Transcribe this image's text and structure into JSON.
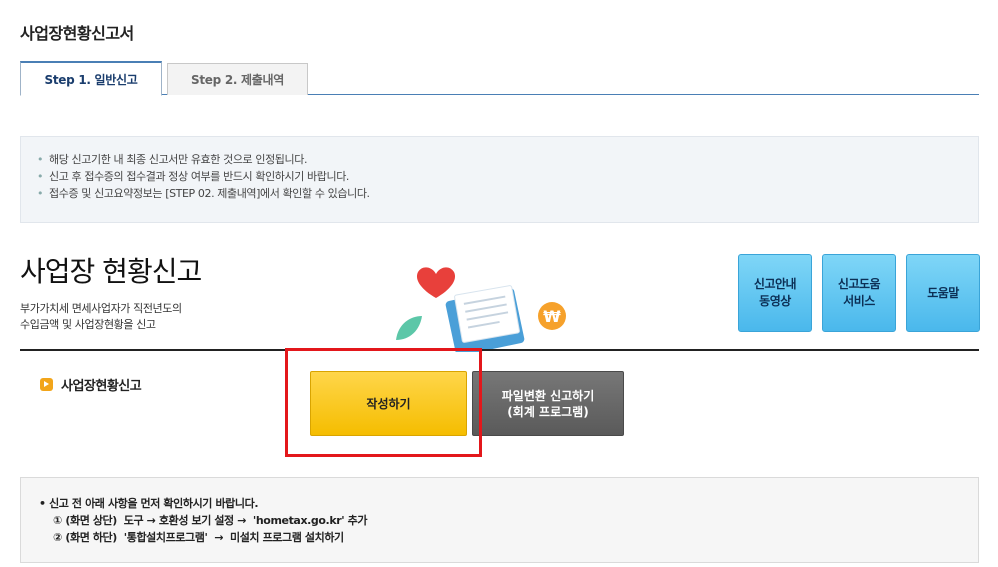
{
  "page": {
    "title": "사업장현황신고서"
  },
  "tabs": [
    {
      "label": "Step 1. 일반신고",
      "active": true
    },
    {
      "label": "Step 2. 제출내역",
      "active": false
    }
  ],
  "notice": {
    "items": [
      "해당 신고기한 내 최종 신고서만 유효한 것으로 인정됩니다.",
      "신고 후 접수증의 접수결과 정상 여부를 반드시 확인하시기 바랍니다.",
      "접수증 및 신고요약정보는 [STEP 02. 제출내역]에서 확인할 수 있습니다."
    ]
  },
  "hero": {
    "title": "사업장 현황신고",
    "subtitle_line1": "부가가치세 면세사업자가 직전년도의",
    "subtitle_line2": "수입금액 및 사업장현황을 신고"
  },
  "help_buttons": [
    {
      "label": "신고안내\n동영상"
    },
    {
      "label": "신고도움\n서비스"
    },
    {
      "label": "도움말"
    }
  ],
  "section": {
    "label": "사업장현황신고"
  },
  "actions": {
    "write_label": "작성하기",
    "convert_label": "파일변환 신고하기\n(회계 프로그램)"
  },
  "notice2": {
    "line1": "신고 전 아래 사항을 먼저 확인하시기 바랍니다.",
    "line2": "① (화면 상단)  도구 → 호환성 보기 설정 →  'hometax.go.kr' 추가",
    "line3": "② (화면 하단)  '통합설치프로그램'  →  미설치 프로그램 설치하기"
  },
  "colors": {
    "tab_accent": "#4a7fb5",
    "help_button": "#4ab8ec",
    "write_button": "#f5bd00",
    "convert_button": "#5a5a5a",
    "highlight": "#e3171b"
  }
}
